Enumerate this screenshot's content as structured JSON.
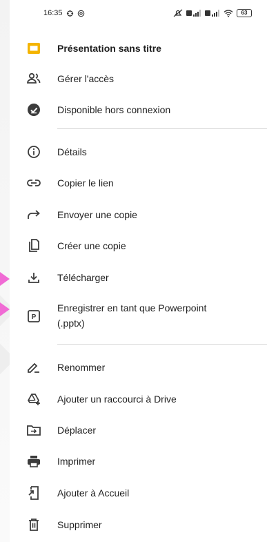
{
  "status_bar": {
    "time": "16:35",
    "battery": "63",
    "icons": [
      "sync-icon",
      "at-icon",
      "muted-icon",
      "signal-icon",
      "signal-icon",
      "wifi-icon",
      "battery-icon"
    ]
  },
  "file": {
    "title": "Présentation sans titre",
    "icon": "slides-file-icon",
    "accent": "#f4b400"
  },
  "menu": {
    "items": [
      {
        "label": "Gérer l'accès",
        "icon": "manage-people-icon"
      },
      {
        "label": "Disponible hors connexion",
        "icon": "offline-check-icon"
      },
      {
        "label": "Détails",
        "icon": "info-icon"
      },
      {
        "label": "Copier le lien",
        "icon": "link-icon"
      },
      {
        "label": "Envoyer une copie",
        "icon": "share-arrow-icon"
      },
      {
        "label": "Créer une copie",
        "icon": "copy-icon"
      },
      {
        "label": "Télécharger",
        "icon": "download-icon"
      },
      {
        "label": "Enregistrer en tant que Powerpoint",
        "label2": "(.pptx)",
        "icon": "powerpoint-icon"
      },
      {
        "label": "Renommer",
        "icon": "rename-pencil-icon"
      },
      {
        "label": "Ajouter un raccourci à Drive",
        "icon": "drive-shortcut-icon"
      },
      {
        "label": "Déplacer",
        "icon": "move-folder-icon"
      },
      {
        "label": "Imprimer",
        "icon": "print-icon"
      },
      {
        "label": "Ajouter à Accueil",
        "icon": "add-home-icon"
      },
      {
        "label": "Supprimer",
        "icon": "trash-icon"
      }
    ]
  },
  "colors": {
    "highlight_arrow": "#f06ad4",
    "icon": "#3c3c3c",
    "divider": "#d6d6d6"
  }
}
